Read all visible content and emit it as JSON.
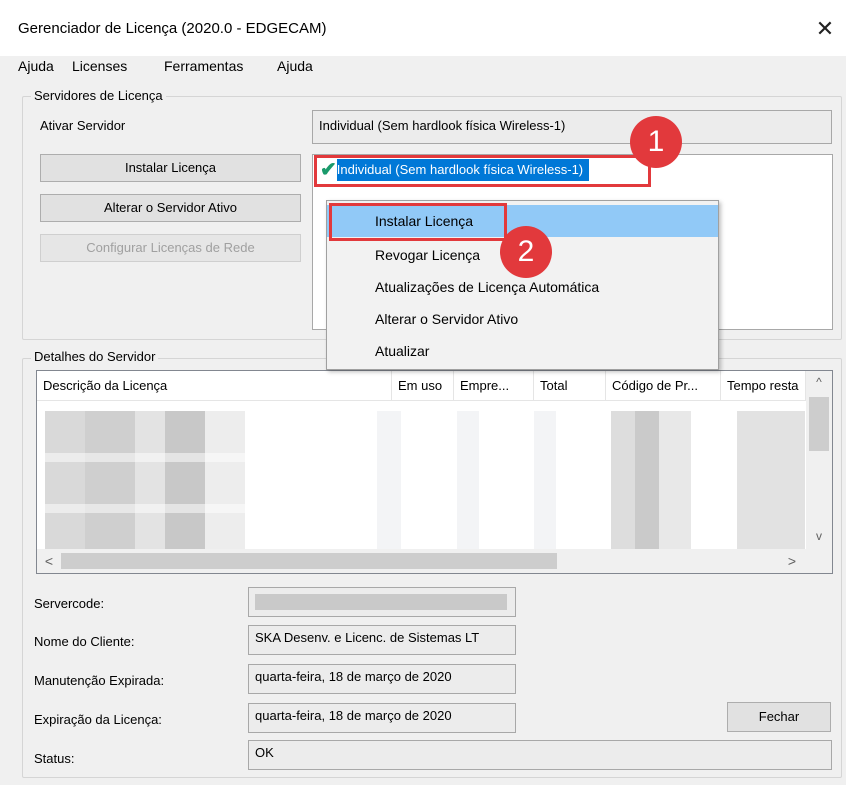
{
  "window": {
    "title": "Gerenciador de Licença (2020.0 - EDGECAM)",
    "close": "✕"
  },
  "menu": [
    "Ajuda",
    "Licenses",
    "Ferramentas",
    "Ajuda"
  ],
  "servers": {
    "group_label": "Servidores de Licença",
    "active_label": "Ativar Servidor",
    "active_value": "Individual (Sem hardlook física Wireless-1)",
    "buttons": {
      "install": "Instalar Licença",
      "change": "Alterar o Servidor Ativo",
      "configure": "Configurar Licenças de Rede"
    },
    "list_item": "Individual (Sem hardlook física Wireless-1)",
    "check": "✔"
  },
  "context_menu": [
    "Instalar Licença",
    "Revogar Licença",
    "Atualizações de Licença Automática",
    "Alterar o Servidor Ativo",
    "Atualizar"
  ],
  "callouts": [
    "1",
    "2"
  ],
  "details": {
    "group_label": "Detalhes do Servidor",
    "columns": [
      "Descrição da Licença",
      "Em uso",
      "Empre...",
      "Total",
      "Código de Pr...",
      "Tempo resta"
    ],
    "scroll": {
      "up": "^",
      "down": "v",
      "left": "<",
      "right": ">"
    },
    "fields": {
      "servercode_label": "Servercode:",
      "servercode_value": "",
      "customer_label": "Nome do Cliente:",
      "customer_value": "SKA Desenv. e Licenc. de Sistemas LT",
      "maintenance_label": "Manutenção Expirada:",
      "maintenance_value": "quarta-feira, 18 de março de 2020",
      "expiry_label": "Expiração da Licença:",
      "expiry_value": "quarta-feira, 18 de março de 2020",
      "status_label": "Status:",
      "status_value": "OK"
    },
    "close_button": "Fechar"
  },
  "colors": {
    "highlight": "#91c9f7",
    "selection": "#0078d7",
    "callout": "#e2393c",
    "check": "#1a9a6b"
  }
}
